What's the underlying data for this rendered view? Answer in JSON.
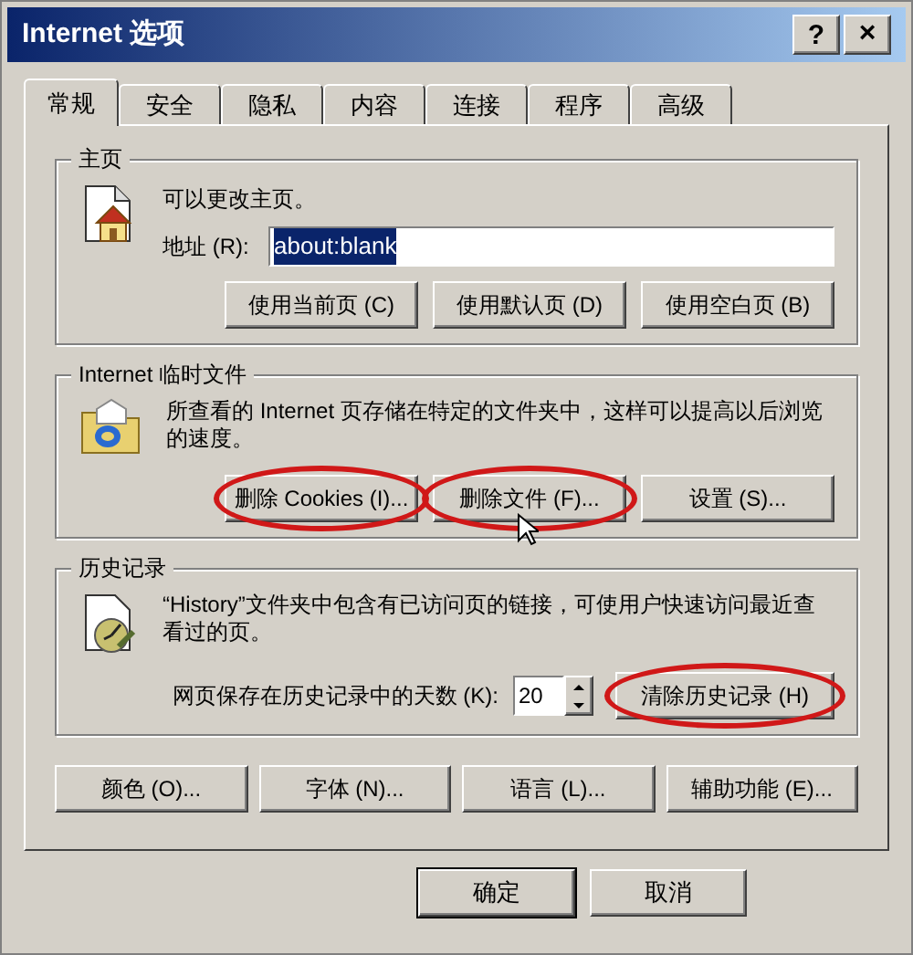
{
  "window": {
    "title": "Internet 选项",
    "help": "?",
    "close": "×"
  },
  "tabs": [
    {
      "label": "常规",
      "selected": true
    },
    {
      "label": "安全",
      "selected": false
    },
    {
      "label": "隐私",
      "selected": false
    },
    {
      "label": "内容",
      "selected": false
    },
    {
      "label": "连接",
      "selected": false
    },
    {
      "label": "程序",
      "selected": false
    },
    {
      "label": "高级",
      "selected": false
    }
  ],
  "homepage": {
    "title": "主页",
    "description": "可以更改主页。",
    "address_label": "地址 (R):",
    "address_value": "about:blank",
    "address_selected": true,
    "buttons": [
      {
        "label": "使用当前页 (C)",
        "circled": false
      },
      {
        "label": "使用默认页 (D)",
        "circled": false
      },
      {
        "label": "使用空白页 (B)",
        "circled": false
      }
    ]
  },
  "temp_files": {
    "title": "Internet 临时文件",
    "description": "所查看的 Internet 页存储在特定的文件夹中，这样可以提高以后浏览的速度。",
    "buttons": [
      {
        "label": "删除 Cookies (I)...",
        "circled": true
      },
      {
        "label": "删除文件 (F)...",
        "circled": true
      },
      {
        "label": "设置 (S)...",
        "circled": false
      }
    ]
  },
  "history": {
    "title": "历史记录",
    "description": "“History”文件夹中包含有已访问页的链接，可使用户快速访问最近查看过的页。",
    "days_label": "网页保存在历史记录中的天数 (K):",
    "days_value": "20",
    "buttons": [
      {
        "label": "清除历史记录 (H)",
        "circled": true
      }
    ]
  },
  "bottom_buttons": [
    {
      "label": "颜色 (O)...",
      "circled": false
    },
    {
      "label": "字体 (N)...",
      "circled": false
    },
    {
      "label": "语言 (L)...",
      "circled": false
    },
    {
      "label": "辅助功能 (E)...",
      "circled": false
    }
  ],
  "dialog_buttons": [
    {
      "label": "确定",
      "default": true
    },
    {
      "label": "取消",
      "default": false
    }
  ]
}
